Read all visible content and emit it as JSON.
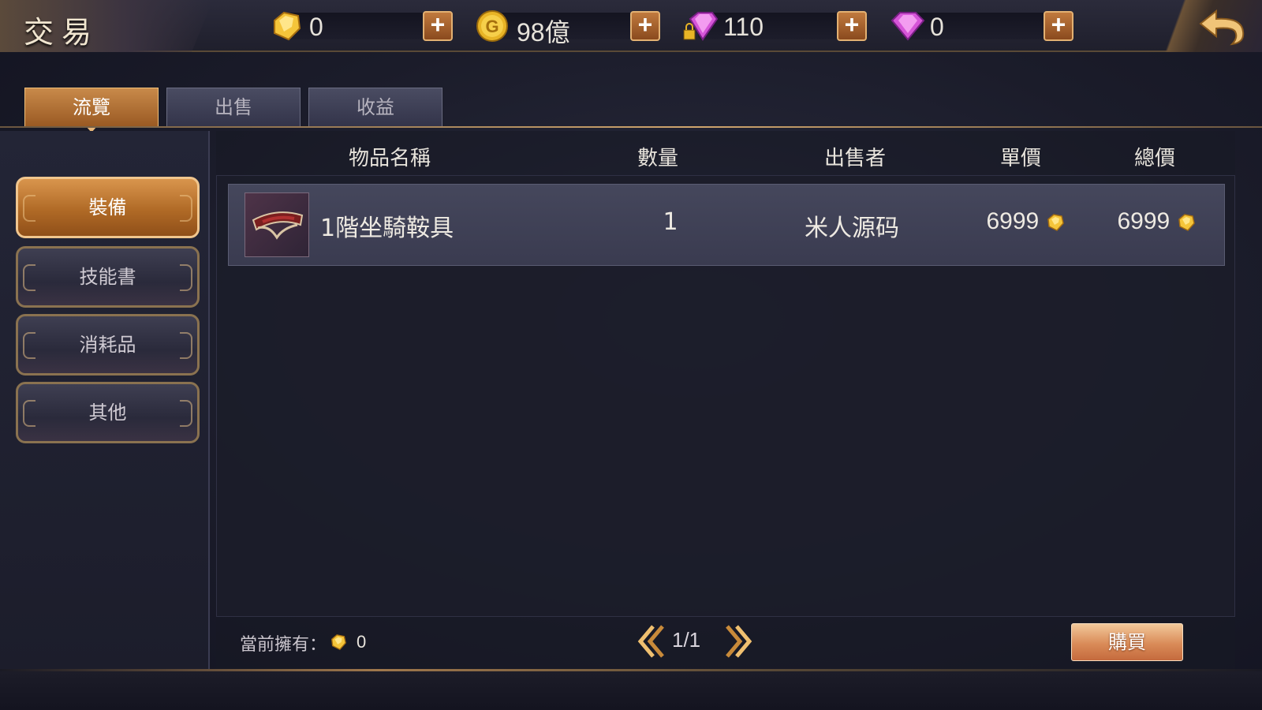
{
  "header": {
    "title": "交易"
  },
  "currencies": [
    {
      "icon": "gold-gem-icon",
      "value": "0"
    },
    {
      "icon": "gold-coin-icon",
      "value": "98億"
    },
    {
      "icon": "locked-purple-diamond-icon",
      "value": "110"
    },
    {
      "icon": "purple-diamond-icon",
      "value": "0"
    }
  ],
  "plus_label": "+",
  "tabs": [
    {
      "label": "流覽",
      "active": true
    },
    {
      "label": "出售",
      "active": false
    },
    {
      "label": "收益",
      "active": false
    }
  ],
  "categories": [
    {
      "label": "裝備",
      "active": true
    },
    {
      "label": "技能書",
      "active": false
    },
    {
      "label": "消耗品",
      "active": false
    },
    {
      "label": "其他",
      "active": false
    }
  ],
  "table": {
    "columns": [
      "物品名稱",
      "數量",
      "出售者",
      "單價",
      "總價"
    ],
    "rows": [
      {
        "icon": "saddle-item-icon",
        "name": "1階坐騎鞍具",
        "quantity": "1",
        "seller": "米人源码",
        "unit_price": "6999",
        "total_price": "6999"
      }
    ]
  },
  "footer": {
    "owned_label": "當前擁有：",
    "owned_value": "0",
    "page": "1/1",
    "buy_label": "購買"
  },
  "colors": {
    "accent_orange": "#c88a4a",
    "gold": "#e9b23a",
    "purple": "#d04fd0"
  }
}
